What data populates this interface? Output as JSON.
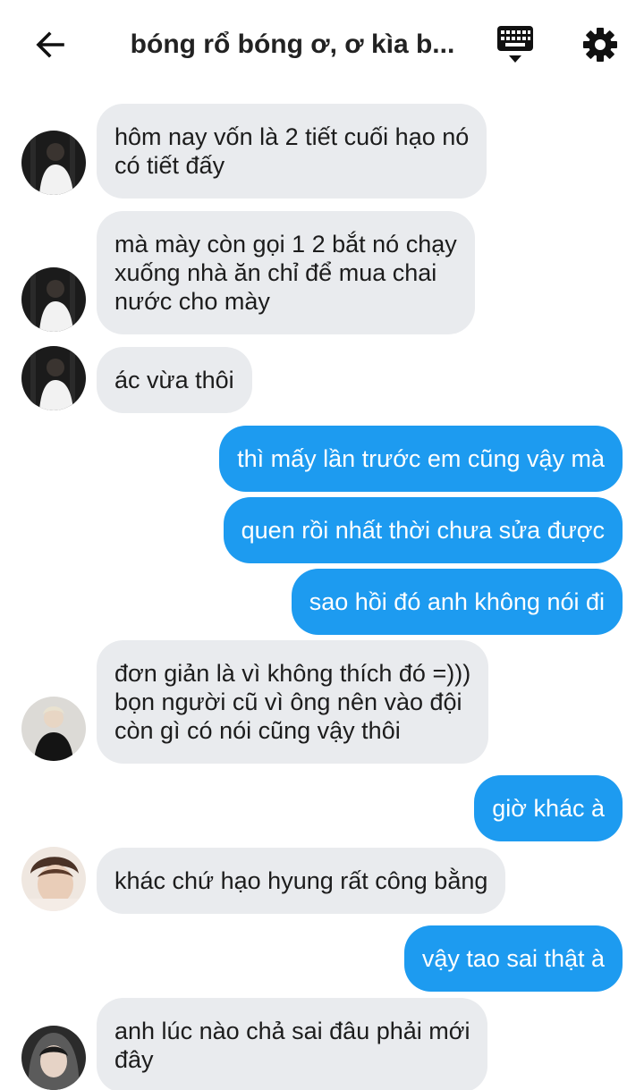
{
  "header": {
    "title": "bóng rổ bóng ơ, ơ kìa b...",
    "back_icon": "arrow-left-icon",
    "keyboard_icon": "keyboard-icon",
    "settings_icon": "gear-icon"
  },
  "colors": {
    "outgoing_bubble": "#1d9bf0",
    "incoming_bubble": "#e9ebee",
    "text_dark": "#1c1c1c"
  },
  "messages": [
    {
      "direction": "in",
      "text": "hôm nay vốn là 2 tiết cuối hạo nó\ncó tiết đấy"
    },
    {
      "direction": "in",
      "text": "mà mày còn gọi 1 2 bắt nó chạy\nxuống nhà ăn chỉ để mua chai\nnước cho mày"
    },
    {
      "direction": "in",
      "text": "ác vừa thôi"
    },
    {
      "direction": "out",
      "text": "thì mấy lần trước em cũng vậy mà"
    },
    {
      "direction": "out",
      "text": "quen rồi nhất thời chưa sửa được"
    },
    {
      "direction": "out",
      "text": "sao hồi đó anh không nói đi"
    },
    {
      "direction": "in",
      "text": "đơn giản là vì không thích đó =)))\nbọn người cũ vì ông nên vào đội\ncòn gì có nói cũng vậy thôi"
    },
    {
      "direction": "out",
      "text": "giờ khác à"
    },
    {
      "direction": "in",
      "text": "khác chứ hạo hyung rất công bằng"
    },
    {
      "direction": "out",
      "text": "vậy tao sai thật à"
    },
    {
      "direction": "in",
      "text": "anh lúc nào chả sai đâu phải mới\nđây"
    }
  ]
}
